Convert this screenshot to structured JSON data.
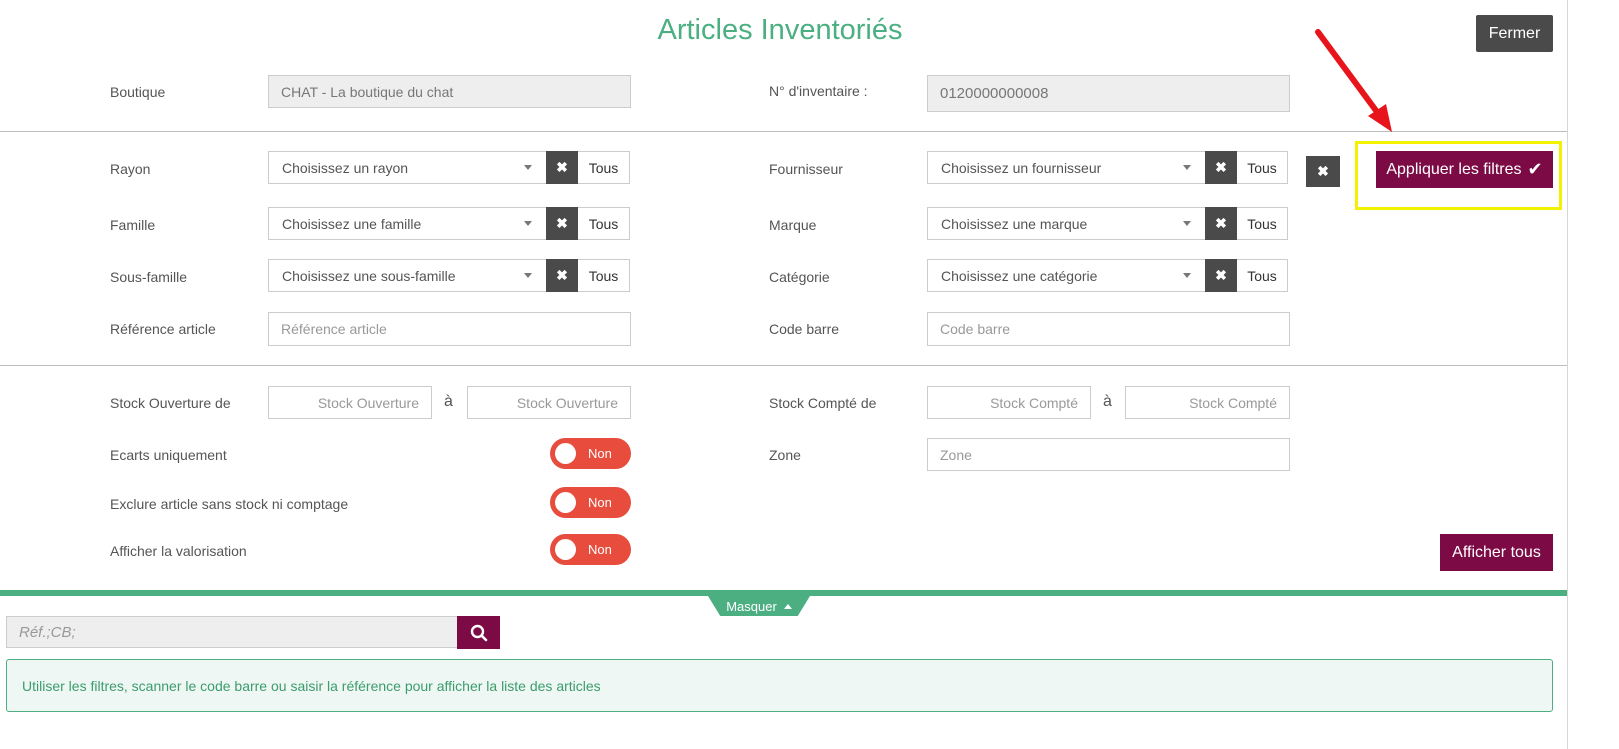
{
  "header": {
    "title": "Articles Inventoriés",
    "close_label": "Fermer"
  },
  "top_fields": {
    "boutique_label": "Boutique",
    "boutique_value": "CHAT - La boutique du chat",
    "inventaire_label": "N° d'inventaire :",
    "inventaire_value": "0120000000008"
  },
  "filters": {
    "tous_label": "Tous",
    "rayon": {
      "label": "Rayon",
      "value": "Choisissez un rayon"
    },
    "famille": {
      "label": "Famille",
      "value": "Choisissez une famille"
    },
    "sous_famille": {
      "label": "Sous-famille",
      "value": "Choisissez une sous-famille"
    },
    "fournisseur": {
      "label": "Fournisseur",
      "value": "Choisissez un fournisseur"
    },
    "marque": {
      "label": "Marque",
      "value": "Choisissez une marque"
    },
    "categorie": {
      "label": "Catégorie",
      "value": "Choisissez une catégorie"
    },
    "reference": {
      "label": "Référence article",
      "placeholder": "Référence article"
    },
    "code_barre": {
      "label": "Code barre",
      "placeholder": "Code barre"
    },
    "apply_label": "Appliquer les filtres"
  },
  "stock": {
    "ouverture_label": "Stock Ouverture de",
    "ouverture_placeholder": "Stock Ouverture",
    "compte_label": "Stock Compté de",
    "compte_placeholder": "Stock Compté",
    "a_label": "à",
    "zone_label": "Zone",
    "zone_placeholder": "Zone"
  },
  "toggles": {
    "ecarts_label": "Ecarts uniquement",
    "exclure_label": "Exclure article sans stock ni comptage",
    "valorisation_label": "Afficher la valorisation",
    "value": "Non"
  },
  "actions": {
    "show_all_label": "Afficher tous",
    "hide_label": "Masquer"
  },
  "search": {
    "placeholder": "Réf.;CB;"
  },
  "info_message": "Utiliser les filtres, scanner le code barre ou saisir la référence pour afficher la liste des articles",
  "colors": {
    "accent_green": "#4caf82",
    "wine": "#7b0a45",
    "toggle_red": "#e84c3d",
    "highlight_yellow": "#f2f200",
    "arrow_red": "#e8141b"
  }
}
